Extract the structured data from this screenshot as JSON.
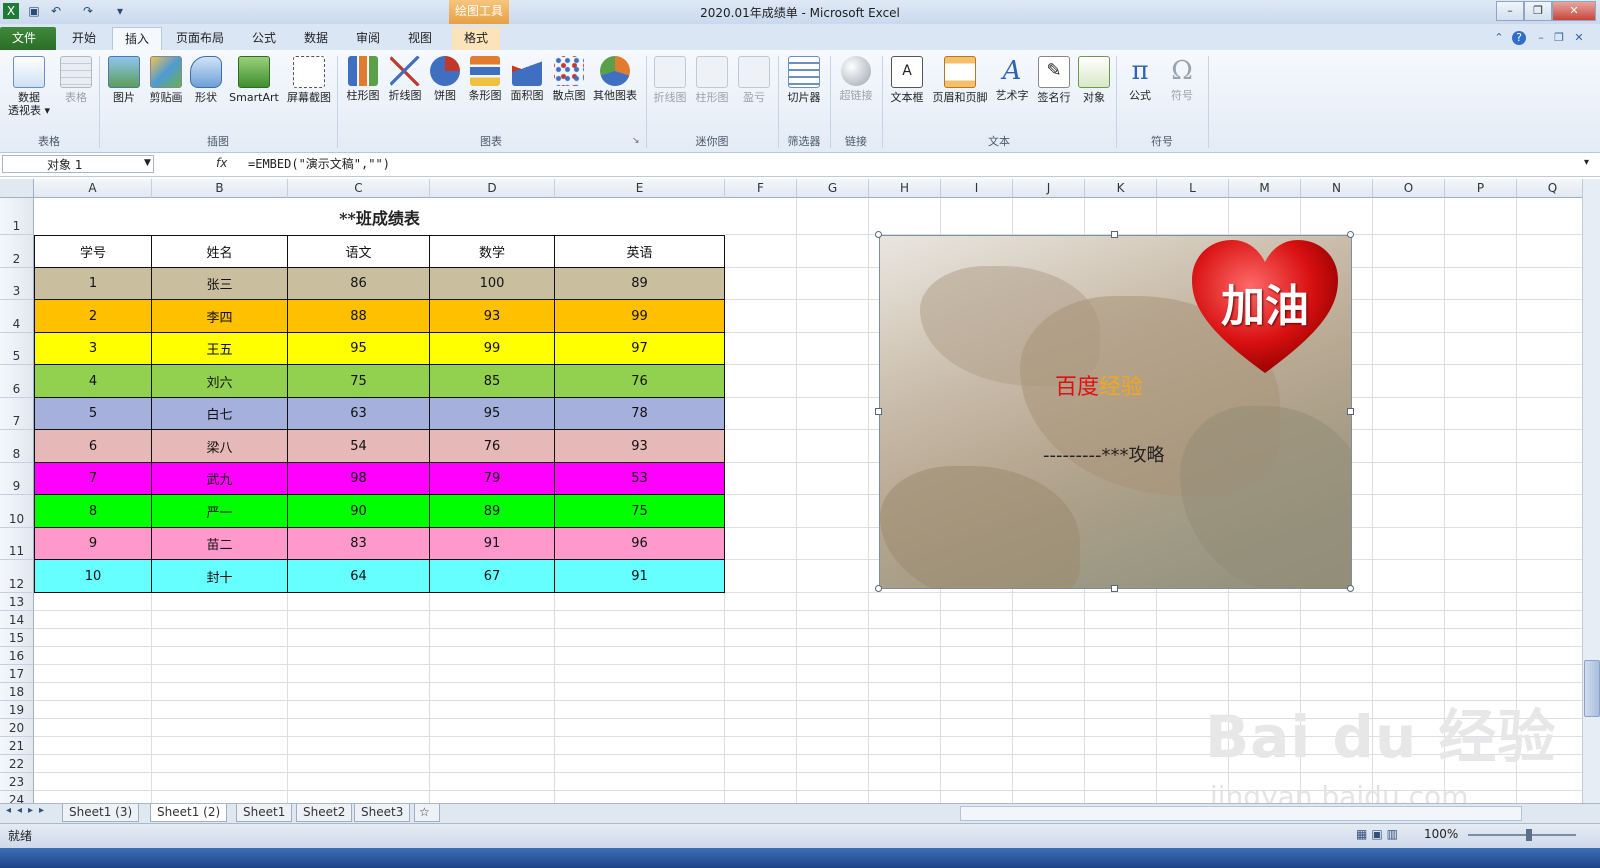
{
  "window": {
    "title": "2020.01年成绩单 - Microsoft Excel",
    "context_tab_group": "绘图工具"
  },
  "tabs": [
    {
      "label": "文件"
    },
    {
      "label": "开始"
    },
    {
      "label": "插入"
    },
    {
      "label": "页面布局"
    },
    {
      "label": "公式"
    },
    {
      "label": "数据"
    },
    {
      "label": "审阅"
    },
    {
      "label": "视图"
    },
    {
      "label": "格式"
    }
  ],
  "ribbon": {
    "groups": [
      {
        "label": "表格",
        "buttons": [
          {
            "label": "数据",
            "label2": "透视表 ▾"
          },
          {
            "label": "表格"
          }
        ]
      },
      {
        "label": "插图",
        "buttons": [
          {
            "label": "图片"
          },
          {
            "label": "剪贴画"
          },
          {
            "label": "形状"
          },
          {
            "label": "SmartArt"
          },
          {
            "label": "屏幕截图"
          }
        ]
      },
      {
        "label": "图表",
        "buttons": [
          {
            "label": "柱形图"
          },
          {
            "label": "折线图"
          },
          {
            "label": "饼图"
          },
          {
            "label": "条形图"
          },
          {
            "label": "面积图"
          },
          {
            "label": "散点图"
          },
          {
            "label": "其他图表"
          }
        ]
      },
      {
        "label": "迷你图",
        "buttons": [
          {
            "label": "折线图"
          },
          {
            "label": "柱形图"
          },
          {
            "label": "盈亏"
          }
        ]
      },
      {
        "label": "筛选器",
        "buttons": [
          {
            "label": "切片器"
          }
        ]
      },
      {
        "label": "链接",
        "buttons": [
          {
            "label": "超链接"
          }
        ]
      },
      {
        "label": "文本",
        "buttons": [
          {
            "label": "文本框"
          },
          {
            "label": "页眉和页脚"
          },
          {
            "label": "艺术字"
          },
          {
            "label": "签名行"
          },
          {
            "label": "对象"
          }
        ]
      },
      {
        "label": "符号",
        "buttons": [
          {
            "label": "公式"
          },
          {
            "label": "符号"
          }
        ]
      }
    ]
  },
  "formula_bar": {
    "name_box": "对象 1",
    "fx": "fx",
    "formula": "=EMBED(\"演示文稿\",\"\")"
  },
  "columns": [
    "A",
    "B",
    "C",
    "D",
    "E",
    "F",
    "G",
    "H",
    "I",
    "J",
    "K",
    "L",
    "M",
    "N",
    "O",
    "P",
    "Q"
  ],
  "rows": [
    "1",
    "2",
    "3",
    "4",
    "5",
    "6",
    "7",
    "8",
    "9",
    "10",
    "11",
    "12",
    "13",
    "14",
    "15",
    "16",
    "17",
    "18",
    "19",
    "20",
    "21",
    "22",
    "23",
    "24"
  ],
  "sheet": {
    "title": "**班成绩表",
    "headers": [
      "学号",
      "姓名",
      "语文",
      "数学",
      "英语"
    ],
    "data": [
      {
        "cells": [
          "1",
          "张三",
          "86",
          "100",
          "89"
        ],
        "color": "#c9bf9e"
      },
      {
        "cells": [
          "2",
          "李四",
          "88",
          "93",
          "99"
        ],
        "color": "#ffc000"
      },
      {
        "cells": [
          "3",
          "王五",
          "95",
          "99",
          "97"
        ],
        "color": "#ffff00"
      },
      {
        "cells": [
          "4",
          "刘六",
          "75",
          "85",
          "76"
        ],
        "color": "#92d050"
      },
      {
        "cells": [
          "5",
          "白七",
          "63",
          "95",
          "78"
        ],
        "color": "#a6b0dc"
      },
      {
        "cells": [
          "6",
          "梁八",
          "54",
          "76",
          "93"
        ],
        "color": "#e6b8b7"
      },
      {
        "cells": [
          "7",
          "武九",
          "98",
          "79",
          "53"
        ],
        "color": "#ff00ff"
      },
      {
        "cells": [
          "8",
          "严一",
          "90",
          "89",
          "75"
        ],
        "color": "#00ff00"
      },
      {
        "cells": [
          "9",
          "苗二",
          "83",
          "91",
          "96"
        ],
        "color": "#ff99cc"
      },
      {
        "cells": [
          "10",
          "封十",
          "64",
          "67",
          "91"
        ],
        "color": "#66ffff"
      }
    ]
  },
  "picture": {
    "heart_text": "加油",
    "text_red": "百度",
    "text_orange": "经验",
    "text_line": "---------***攻略"
  },
  "sheet_tabs": [
    "Sheet1 (3)",
    "Sheet1 (2)",
    "Sheet1",
    "Sheet2",
    "Sheet3"
  ],
  "status": {
    "ready": "就绪",
    "zoom": "100%"
  },
  "watermark": {
    "main": "Bai du 经验",
    "sub": "jingyan.baidu.com"
  },
  "colors": {
    "accent": "#2b6d27",
    "context_tab": "#e8a042"
  }
}
